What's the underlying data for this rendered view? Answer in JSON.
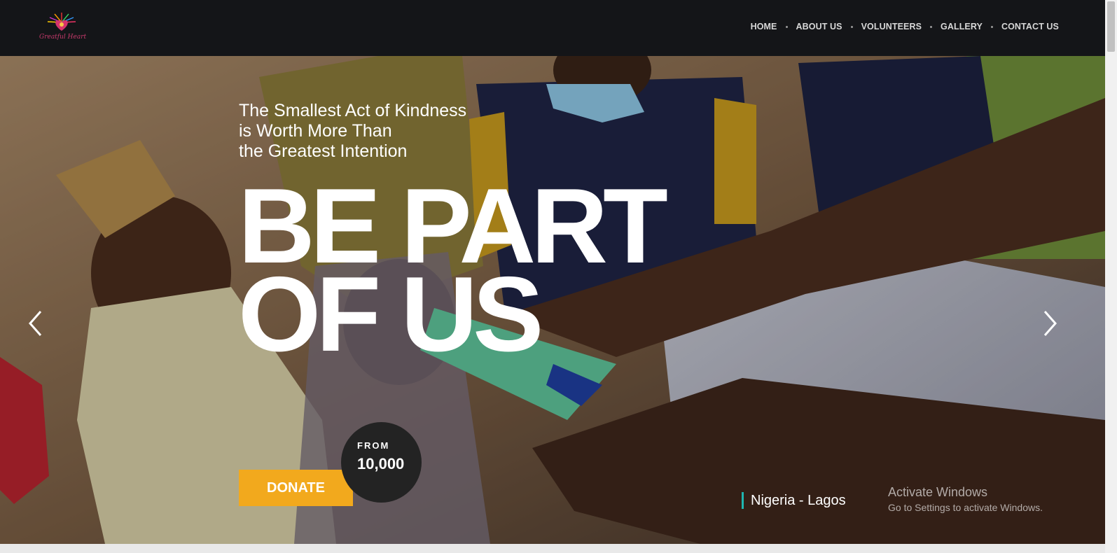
{
  "nav": {
    "logo_text": "Greatful Heart",
    "items": [
      "HOME",
      "ABOUT US",
      "VOLUNTEERS",
      "GALLERY",
      "CONTACT US"
    ]
  },
  "hero": {
    "tagline": [
      "The Smallest Act of Kindness",
      "is Worth More Than",
      "the Greatest Intention"
    ],
    "headline": [
      "BE PART",
      "OF US"
    ],
    "donate_label": "DONATE",
    "price_label": "FROM",
    "price_value": "10,000",
    "location": "Nigeria - Lagos",
    "accent_color": "#f2a91d",
    "location_bar_color": "#1fb5b0"
  },
  "system": {
    "activate_title": "Activate Windows",
    "activate_sub": "Go to Settings to activate Windows."
  }
}
